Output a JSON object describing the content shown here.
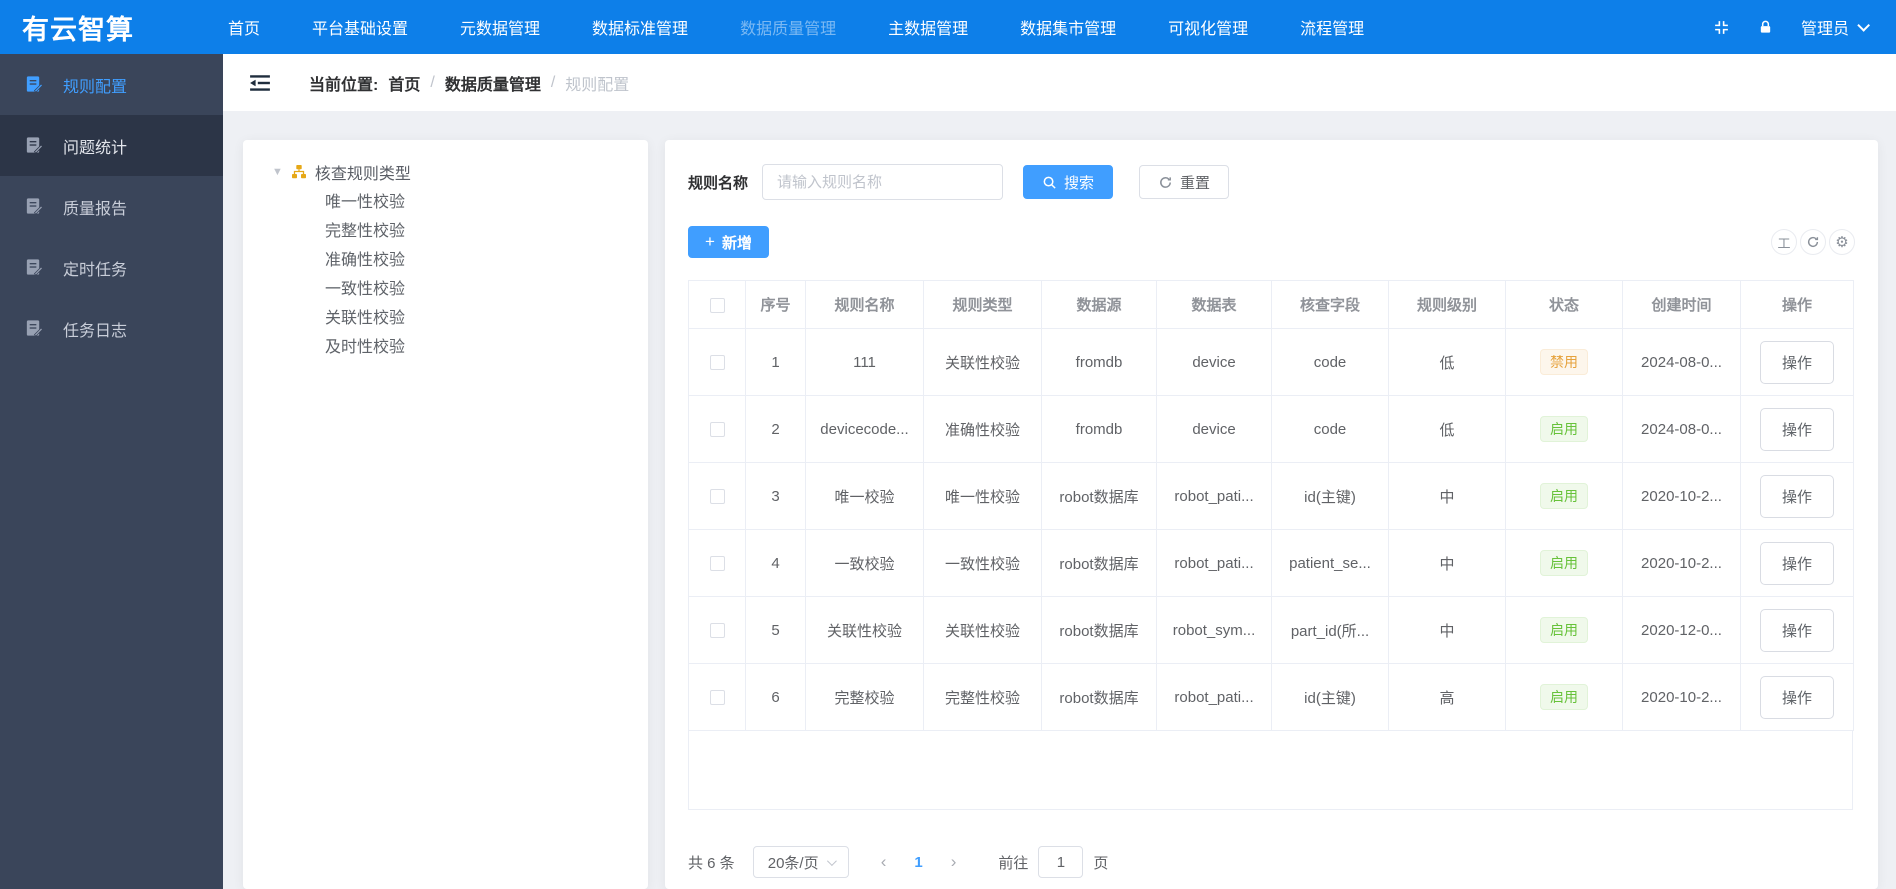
{
  "navbar": {
    "logo": "有云智算",
    "items": [
      {
        "label": "首页"
      },
      {
        "label": "平台基础设置"
      },
      {
        "label": "元数据管理"
      },
      {
        "label": "数据标准管理"
      },
      {
        "label": "数据质量管理"
      },
      {
        "label": "主数据管理"
      },
      {
        "label": "数据集市管理"
      },
      {
        "label": "可视化管理"
      },
      {
        "label": "流程管理"
      }
    ],
    "active_item": "数据质量管理",
    "user": "管理员",
    "icons": [
      "fullscreen-icon",
      "lock-icon",
      "chevron-down-icon"
    ]
  },
  "sidebar": {
    "items": [
      {
        "label": "规则配置",
        "state": "active"
      },
      {
        "label": "问题统计",
        "state": "highlighted"
      },
      {
        "label": "质量报告",
        "state": "normal"
      },
      {
        "label": "定时任务",
        "state": "normal"
      },
      {
        "label": "任务日志",
        "state": "normal"
      }
    ],
    "item_icon": "document-edit-icon"
  },
  "breadcrumb": {
    "prefix": "当前位置:",
    "items": [
      "首页",
      "数据质量管理",
      "规则配置"
    ],
    "separator": "/"
  },
  "tree": {
    "root": "核查规则类型",
    "root_icon": "org-chart-icon",
    "children": [
      "唯一性校验",
      "完整性校验",
      "准确性校验",
      "一致性校验",
      "关联性校验",
      "及时性校验"
    ]
  },
  "search": {
    "label": "规则名称",
    "placeholder": "请输入规则名称",
    "search_label": "搜索",
    "reset_label": "重置"
  },
  "toolbar": {
    "add_label": "新增",
    "icons": [
      "row-height-icon",
      "refresh-icon",
      "gear-icon"
    ],
    "row_height_glyph": "工"
  },
  "table": {
    "headers": [
      "序号",
      "规则名称",
      "规则类型",
      "数据源",
      "数据表",
      "核查字段",
      "规则级别",
      "状态",
      "创建时间",
      "操作"
    ],
    "action_label": "操作",
    "rows": [
      {
        "no": "1",
        "name": "111",
        "type": "关联性校验",
        "source": "fromdb",
        "table": "device",
        "field": "code",
        "level": "低",
        "status": "禁用",
        "status_type": "warning",
        "created": "2024-08-0..."
      },
      {
        "no": "2",
        "name": "devicecode...",
        "type": "准确性校验",
        "source": "fromdb",
        "table": "device",
        "field": "code",
        "level": "低",
        "status": "启用",
        "status_type": "success",
        "created": "2024-08-0..."
      },
      {
        "no": "3",
        "name": "唯一校验",
        "type": "唯一性校验",
        "source": "robot数据库",
        "table": "robot_pati...",
        "field": "id(主键)",
        "level": "中",
        "status": "启用",
        "status_type": "success",
        "created": "2020-10-2..."
      },
      {
        "no": "4",
        "name": "一致校验",
        "type": "一致性校验",
        "source": "robot数据库",
        "table": "robot_pati...",
        "field": "patient_se...",
        "level": "中",
        "status": "启用",
        "status_type": "success",
        "created": "2020-10-2..."
      },
      {
        "no": "5",
        "name": "关联性校验",
        "type": "关联性校验",
        "source": "robot数据库",
        "table": "robot_sym...",
        "field": "part_id(所...",
        "level": "中",
        "status": "启用",
        "status_type": "success",
        "created": "2020-12-0..."
      },
      {
        "no": "6",
        "name": "完整校验",
        "type": "完整性校验",
        "source": "robot数据库",
        "table": "robot_pati...",
        "field": "id(主键)",
        "level": "高",
        "status": "启用",
        "status_type": "success",
        "created": "2020-10-2..."
      }
    ]
  },
  "pagination": {
    "total": "共 6 条",
    "page_size": "20条/页",
    "prev": "‹",
    "next": "›",
    "current_page": "1",
    "goto_label": "前往",
    "goto_value": "1",
    "page_label": "页"
  },
  "colors": {
    "navbar_blue": "#0d7fe9",
    "sidebar_dark": "#3a455a",
    "sidebar_highlight": "#2c3547",
    "accent_blue": "#409eff",
    "success_green": "#67c23a",
    "warning_orange": "#e6a23c",
    "tree_icon_yellow": "#e6a817"
  }
}
